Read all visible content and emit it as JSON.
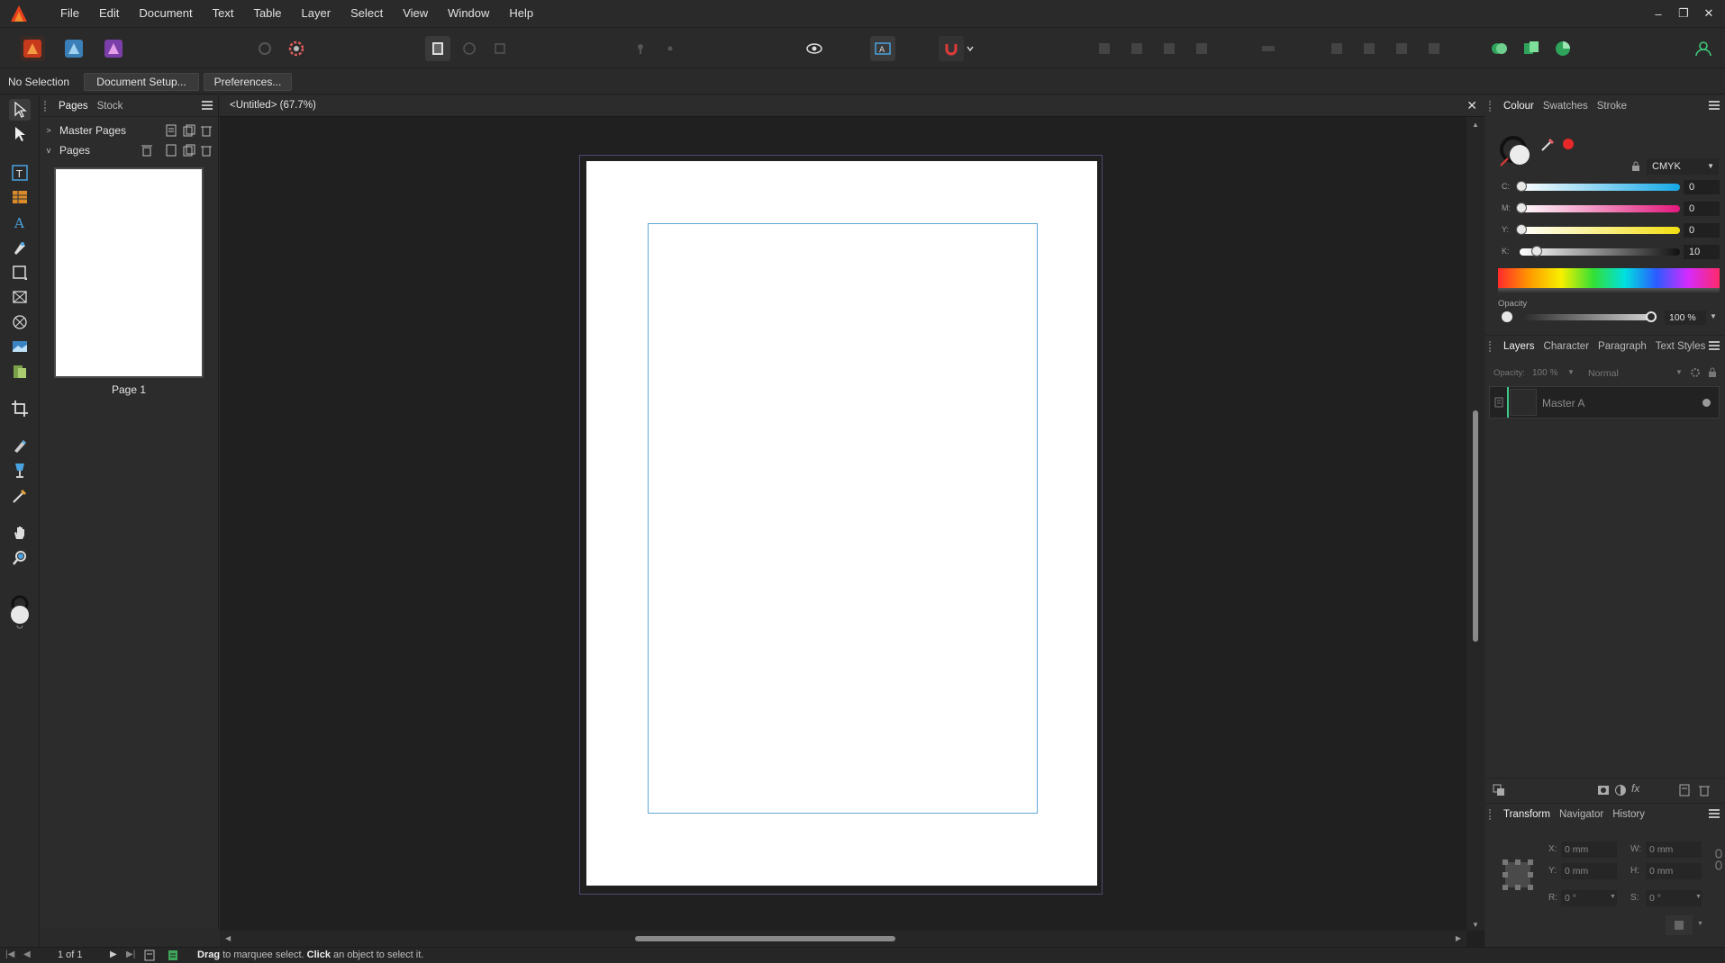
{
  "menu": [
    "File",
    "Edit",
    "Document",
    "Text",
    "Table",
    "Layer",
    "Select",
    "View",
    "Window",
    "Help"
  ],
  "window_controls": {
    "minimize": "–",
    "restore": "❐",
    "close": "✕"
  },
  "context_bar": {
    "selection": "No Selection",
    "document_setup": "Document Setup...",
    "preferences": "Preferences..."
  },
  "pages_panel": {
    "tabs": [
      "Pages",
      "Stock"
    ],
    "master_pages": "Master Pages",
    "pages": "Pages",
    "page_label": "Page 1"
  },
  "document": {
    "title": "<Untitled> (67.7%)",
    "close": "✕"
  },
  "colour_panel": {
    "tabs": [
      "Colour",
      "Swatches",
      "Stroke"
    ],
    "model": "CMYK",
    "channels": [
      {
        "label": "C:",
        "value": "0",
        "fraction": 0.0
      },
      {
        "label": "M:",
        "value": "0",
        "fraction": 0.0
      },
      {
        "label": "Y:",
        "value": "0",
        "fraction": 0.0
      },
      {
        "label": "K:",
        "value": "10",
        "fraction": 0.1
      }
    ],
    "opacity_label": "Opacity",
    "opacity_value": "100 %",
    "opacity_fraction": 1.0
  },
  "layers_panel": {
    "tabs": [
      "Layers",
      "Character",
      "Paragraph",
      "Text Styles"
    ],
    "opacity_label": "Opacity:",
    "opacity_value": "100 %",
    "blend_mode": "Normal",
    "layer_name": "Master A"
  },
  "transform_panel": {
    "tabs": [
      "Transform",
      "Navigator",
      "History"
    ],
    "x_label": "X:",
    "x_value": "0 mm",
    "y_label": "Y:",
    "y_value": "0 mm",
    "w_label": "W:",
    "w_value": "0 mm",
    "h_label": "H:",
    "h_value": "0 mm",
    "r_label": "R:",
    "r_value": "0 °",
    "s_label": "S:",
    "s_value": "0 °"
  },
  "status_bar": {
    "page_counter": "1 of 1",
    "hint_bold_1": "Drag",
    "hint_text_1": " to marquee select. ",
    "hint_bold_2": "Click",
    "hint_text_2": " an object to select it."
  },
  "colors": {
    "accent": "#e8401c",
    "guide": "#5fa7d8",
    "spread": "#4e4a74"
  }
}
